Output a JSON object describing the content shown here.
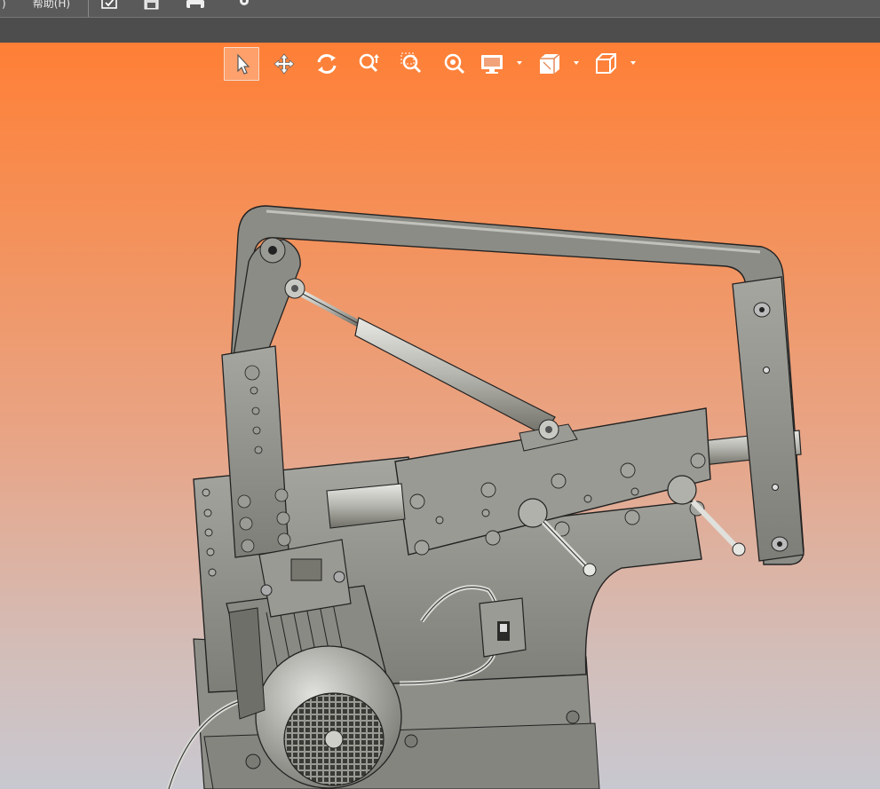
{
  "menubar": {
    "items": [
      ")",
      "帮助(H)"
    ]
  },
  "quick_access": {
    "icons": [
      "check-window-icon",
      "save-icon",
      "print-icon",
      "settings-icon"
    ]
  },
  "view_toolbar": {
    "tools": [
      {
        "name": "select-tool",
        "icon": "cursor-arrow-icon",
        "active": true
      },
      {
        "name": "pan-tool",
        "icon": "move-cross-icon",
        "active": false
      },
      {
        "name": "rotate-tool",
        "icon": "rotate-icon",
        "active": false
      },
      {
        "name": "zoom-dynamic-tool",
        "icon": "zoom-updown-icon",
        "active": false
      },
      {
        "name": "zoom-window-tool",
        "icon": "zoom-window-icon",
        "active": false
      },
      {
        "name": "zoom-fit-tool",
        "icon": "zoom-fit-icon",
        "active": false
      },
      {
        "name": "display-mode-dropdown",
        "icon": "monitor-icon",
        "active": false
      },
      {
        "name": "view-orientation-dropdown",
        "icon": "cube-views-icon",
        "active": false
      },
      {
        "name": "standard-view-dropdown",
        "icon": "cube-icon",
        "active": false
      }
    ]
  },
  "colors": {
    "menubar_bg": "#5a5a5a",
    "subbar_bg": "#4d4d4d",
    "viewport_top": "#ff7f36",
    "viewport_bottom": "#c8c8d0",
    "model_gray": "#8c8c86"
  },
  "model": {
    "description_icon": "belt-grinder-model"
  }
}
